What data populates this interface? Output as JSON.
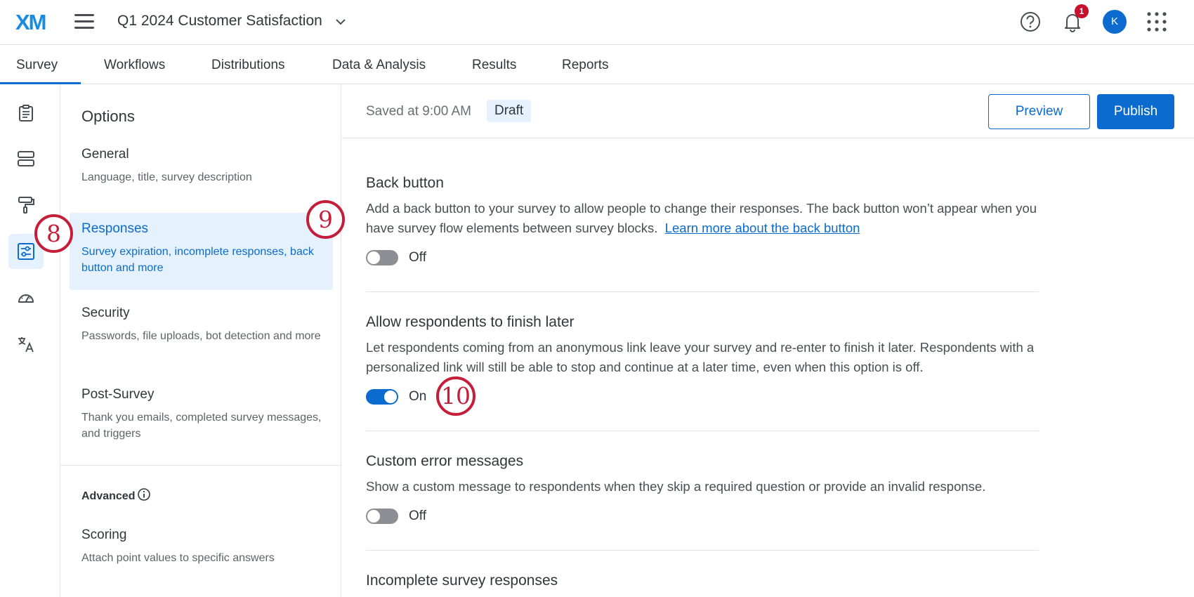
{
  "header": {
    "logo": "XM",
    "survey_title": "Q1 2024 Customer Satisfaction",
    "notification_count": "1",
    "avatar_initial": "K"
  },
  "tabs": [
    {
      "label": "Survey",
      "active": true
    },
    {
      "label": "Workflows"
    },
    {
      "label": "Distributions"
    },
    {
      "label": "Data & Analysis"
    },
    {
      "label": "Results"
    },
    {
      "label": "Reports"
    }
  ],
  "options": {
    "title": "Options",
    "items": [
      {
        "title": "General",
        "desc": "Language, title, survey description"
      },
      {
        "title": "Responses",
        "desc": "Survey expiration, incomplete responses, back button and more",
        "active": true
      },
      {
        "title": "Security",
        "desc": "Passwords, file uploads, bot detection and more"
      },
      {
        "title": "Post-Survey",
        "desc": "Thank you emails, completed survey messages, and triggers"
      }
    ],
    "advanced_label": "Advanced",
    "advanced_items": [
      {
        "title": "Scoring",
        "desc": "Attach point values to specific answers"
      }
    ]
  },
  "main": {
    "saved_text": "Saved at 9:00 AM",
    "draft_label": "Draft",
    "preview_label": "Preview",
    "publish_label": "Publish",
    "settings": [
      {
        "title": "Back button",
        "desc": "Add a back button to your survey to allow people to change their responses. The back button won’t appear when you have survey flow elements between survey blocks.",
        "link": "Learn more about the back button",
        "state_label": "Off",
        "on": false
      },
      {
        "title": "Allow respondents to finish later",
        "desc": "Let respondents coming from an anonymous link leave your survey and re-enter to finish it later. Respondents with a personalized link will still be able to stop and continue at a later time, even when this option is off.",
        "state_label": "On",
        "on": true
      },
      {
        "title": "Custom error messages",
        "desc": "Show a custom message to respondents when they skip a required question or provide an invalid response.",
        "state_label": "Off",
        "on": false
      },
      {
        "title": "Incomplete survey responses"
      }
    ]
  },
  "callouts": [
    "8",
    "9",
    "10"
  ],
  "colors": {
    "accent": "#0b6bce",
    "callout": "#c41e3a",
    "active_bg": "#e5f1fc"
  }
}
